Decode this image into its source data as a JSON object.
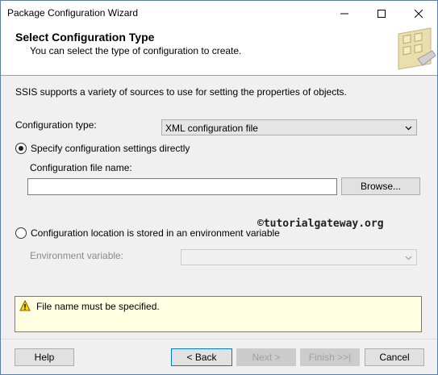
{
  "window": {
    "title": "Package Configuration Wizard"
  },
  "header": {
    "title": "Select Configuration Type",
    "subtitle": "You can select the type of configuration to create."
  },
  "intro": "SSIS supports a variety of sources to use for setting the properties of objects.",
  "config_type": {
    "label": "Configuration type:",
    "selected": "XML configuration file"
  },
  "option_direct": {
    "label": "Specify configuration settings directly",
    "checked": true
  },
  "file_name": {
    "label": "Configuration file name:",
    "value": ""
  },
  "browse_label": "Browse...",
  "watermark": "©tutorialgateway.org",
  "option_env": {
    "label": "Configuration location is stored in an environment variable",
    "checked": false
  },
  "env_variable": {
    "label": "Environment variable:",
    "selected": ""
  },
  "message": "File name must be specified.",
  "footer": {
    "help": "Help",
    "back": "< Back",
    "next": "Next >",
    "finish": "Finish >>|",
    "cancel": "Cancel"
  },
  "colors": {
    "message_bg": "#ffffe1",
    "default_button_border": "#0078d7"
  }
}
